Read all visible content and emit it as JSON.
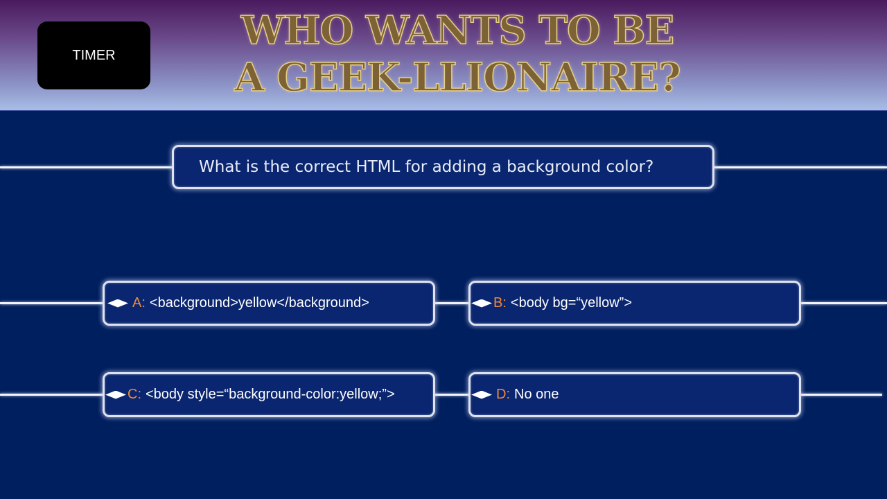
{
  "timer": {
    "label": "TIMER"
  },
  "title": {
    "line1": "WHO WANTS TO BE",
    "line2": "A GEEK-LLIONAIRE?"
  },
  "question": {
    "text": "What is the correct HTML for adding a background color?"
  },
  "answers": [
    {
      "letter": "A:",
      "text": "<background>yellow</background>"
    },
    {
      "letter": "B:",
      "text": "<body bg=“yellow”>"
    },
    {
      "letter": "C:",
      "text": "<body style=“background-color:yellow;”>"
    },
    {
      "letter": "D:",
      "text": "No one"
    }
  ],
  "colors": {
    "background": "#001f5e",
    "letter_accent": "#f0883a",
    "title_gold": "#7d6236"
  }
}
